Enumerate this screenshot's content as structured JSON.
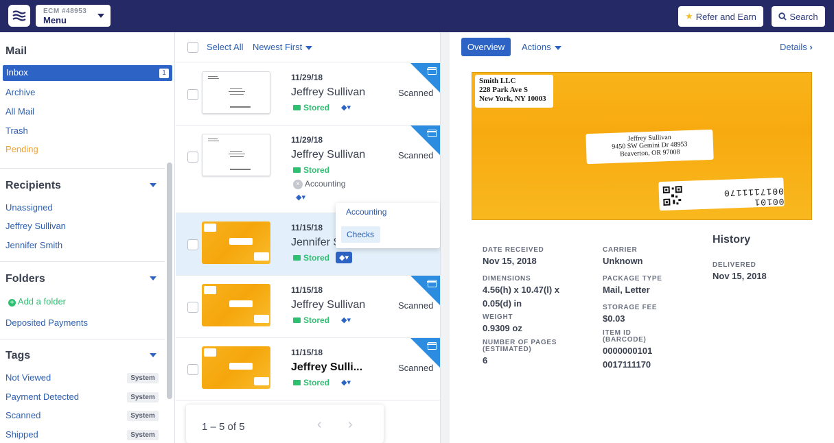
{
  "topbar": {
    "account_id": "ECM #48953",
    "menu_label": "Menu",
    "refer_label": "Refer and Earn",
    "search_label": "Search"
  },
  "sidebar": {
    "mail_heading": "Mail",
    "mail_items": [
      {
        "label": "Inbox",
        "count": "1"
      },
      {
        "label": "Archive"
      },
      {
        "label": "All Mail"
      },
      {
        "label": "Trash"
      },
      {
        "label": "Pending"
      }
    ],
    "recipients_heading": "Recipients",
    "recipients": [
      "Unassigned",
      "Jeffrey Sullivan",
      "Jennifer Smith"
    ],
    "folders_heading": "Folders",
    "add_folder": "Add a folder",
    "folders": [
      "Deposited Payments"
    ],
    "tags_heading": "Tags",
    "tags": [
      {
        "label": "Not Viewed",
        "badge": "System"
      },
      {
        "label": "Payment Detected",
        "badge": "System"
      },
      {
        "label": "Scanned",
        "badge": "System"
      },
      {
        "label": "Shipped",
        "badge": "System"
      }
    ]
  },
  "list": {
    "select_all": "Select All",
    "sort": "Newest First",
    "rows": [
      {
        "date": "11/29/18",
        "sender": "Jeffrey Sullivan",
        "status": "Scanned",
        "folder": "Stored",
        "thumb": "white"
      },
      {
        "date": "11/29/18",
        "sender": "Jeffrey Sullivan",
        "status": "Scanned",
        "folder": "Stored",
        "tag": "Accounting",
        "thumb": "white"
      },
      {
        "date": "11/15/18",
        "sender": "Jennifer S",
        "status": "",
        "folder": "Stored",
        "thumb": "yellow"
      },
      {
        "date": "11/15/18",
        "sender": "Jeffrey Sullivan",
        "status": "Scanned",
        "folder": "Stored",
        "thumb": "yellow"
      },
      {
        "date": "11/15/18",
        "sender": "Jeffrey Sulli...",
        "status": "Scanned",
        "folder": "Stored",
        "thumb": "yellow"
      }
    ],
    "tag_dropdown": [
      "Accounting",
      "Checks"
    ],
    "pagination": "1 – 5 of 5"
  },
  "detail": {
    "overview_label": "Overview",
    "actions_label": "Actions",
    "details_label": "Details",
    "scan": {
      "return_address": [
        "Smith LLC",
        "228 Park Ave S",
        "New York, NY 10003"
      ],
      "recipient_address": [
        "Jeffrey Sullivan",
        "9450 SW Gemini Dr 48953",
        "Beaverton, OR 97008"
      ],
      "barcode_text": "00101 0017111170"
    },
    "fields": {
      "date_received_label": "DATE RECEIVED",
      "date_received": "Nov 15, 2018",
      "dimensions_label": "DIMENSIONS",
      "dimensions_1": "4.56(h) x 10.47(l) x",
      "dimensions_2": "0.05(d) in",
      "weight_label": "WEIGHT",
      "weight": "0.9309 oz",
      "pages_label_1": "NUMBER OF PAGES",
      "pages_label_2": "(ESTIMATED)",
      "pages": "6",
      "carrier_label": "CARRIER",
      "carrier": "Unknown",
      "package_type_label": "PACKAGE TYPE",
      "package_type": "Mail, Letter",
      "storage_fee_label": "STORAGE FEE",
      "storage_fee": "$0.03",
      "item_id_label_1": "ITEM ID",
      "item_id_label_2": "(BARCODE)",
      "item_id_1": "0000000101",
      "item_id_2": "0017111170"
    },
    "history_heading": "History",
    "history": [
      {
        "label": "DELIVERED",
        "date": "Nov 15, 2018"
      }
    ]
  },
  "colors": {
    "topbar": "#252a66",
    "accent": "#2c63c4",
    "stored_green": "#2fbf71",
    "pending_orange": "#f0a030",
    "envelope_yellow": "#f7aa0f"
  }
}
